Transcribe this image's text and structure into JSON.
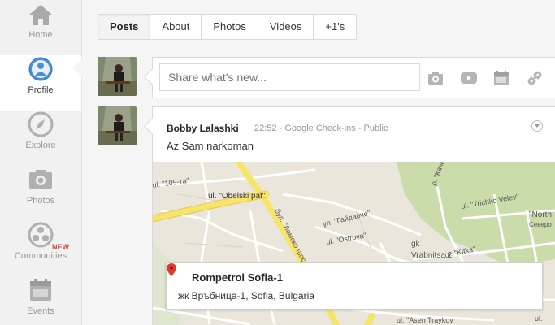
{
  "rail": {
    "items": [
      {
        "label": "Home",
        "icon": "home-icon"
      },
      {
        "label": "Profile",
        "icon": "profile-icon"
      },
      {
        "label": "Explore",
        "icon": "compass-icon"
      },
      {
        "label": "Photos",
        "icon": "camera-icon"
      },
      {
        "label": "Communities",
        "icon": "communities-icon"
      },
      {
        "label": "Events",
        "icon": "calendar-icon"
      }
    ],
    "new_badge": "NEW"
  },
  "tabs": [
    "Posts",
    "About",
    "Photos",
    "Videos",
    "+1's"
  ],
  "share": {
    "placeholder": "Share what's new...",
    "buttons": [
      "camera-icon",
      "video-icon",
      "event-icon",
      "link-icon"
    ]
  },
  "post": {
    "author": "Bobby Lalashki",
    "time": "22:52",
    "sep1": " - ",
    "source": "Google Check-ins",
    "sep2": " - ",
    "visibility": "Public",
    "text": "Az Sam narkoman",
    "place": {
      "name": "Rompetrol Sofia-1",
      "address": "жк Връбница-1, Sofia, Bulgaria"
    },
    "map_labels": {
      "street1": "ul. \"Obelski pat\"",
      "street2": "бул. \"Ломско шосе\"",
      "street3": "ul. \"109-та\"",
      "street4": "ул. \"Гайдарче\"",
      "street5": "ul. \"Ostrova\"",
      "street6": "ul. \"Trichko Velev\"",
      "street7": "Vrabnitsa 2",
      "street8": "gk",
      "street9": "\"North",
      "street10": "Северо",
      "street11": "ul. \"Asen Traykov",
      "street12": "ul.",
      "street13": "ul. \"Kitka\"",
      "street14": "р. \"Качен\""
    }
  },
  "colors": {
    "accent": "#4285f4",
    "new_badge": "#d14836",
    "road_major": "#f7e56b",
    "park": "#cbdcab",
    "pin": "#d93f2f"
  }
}
